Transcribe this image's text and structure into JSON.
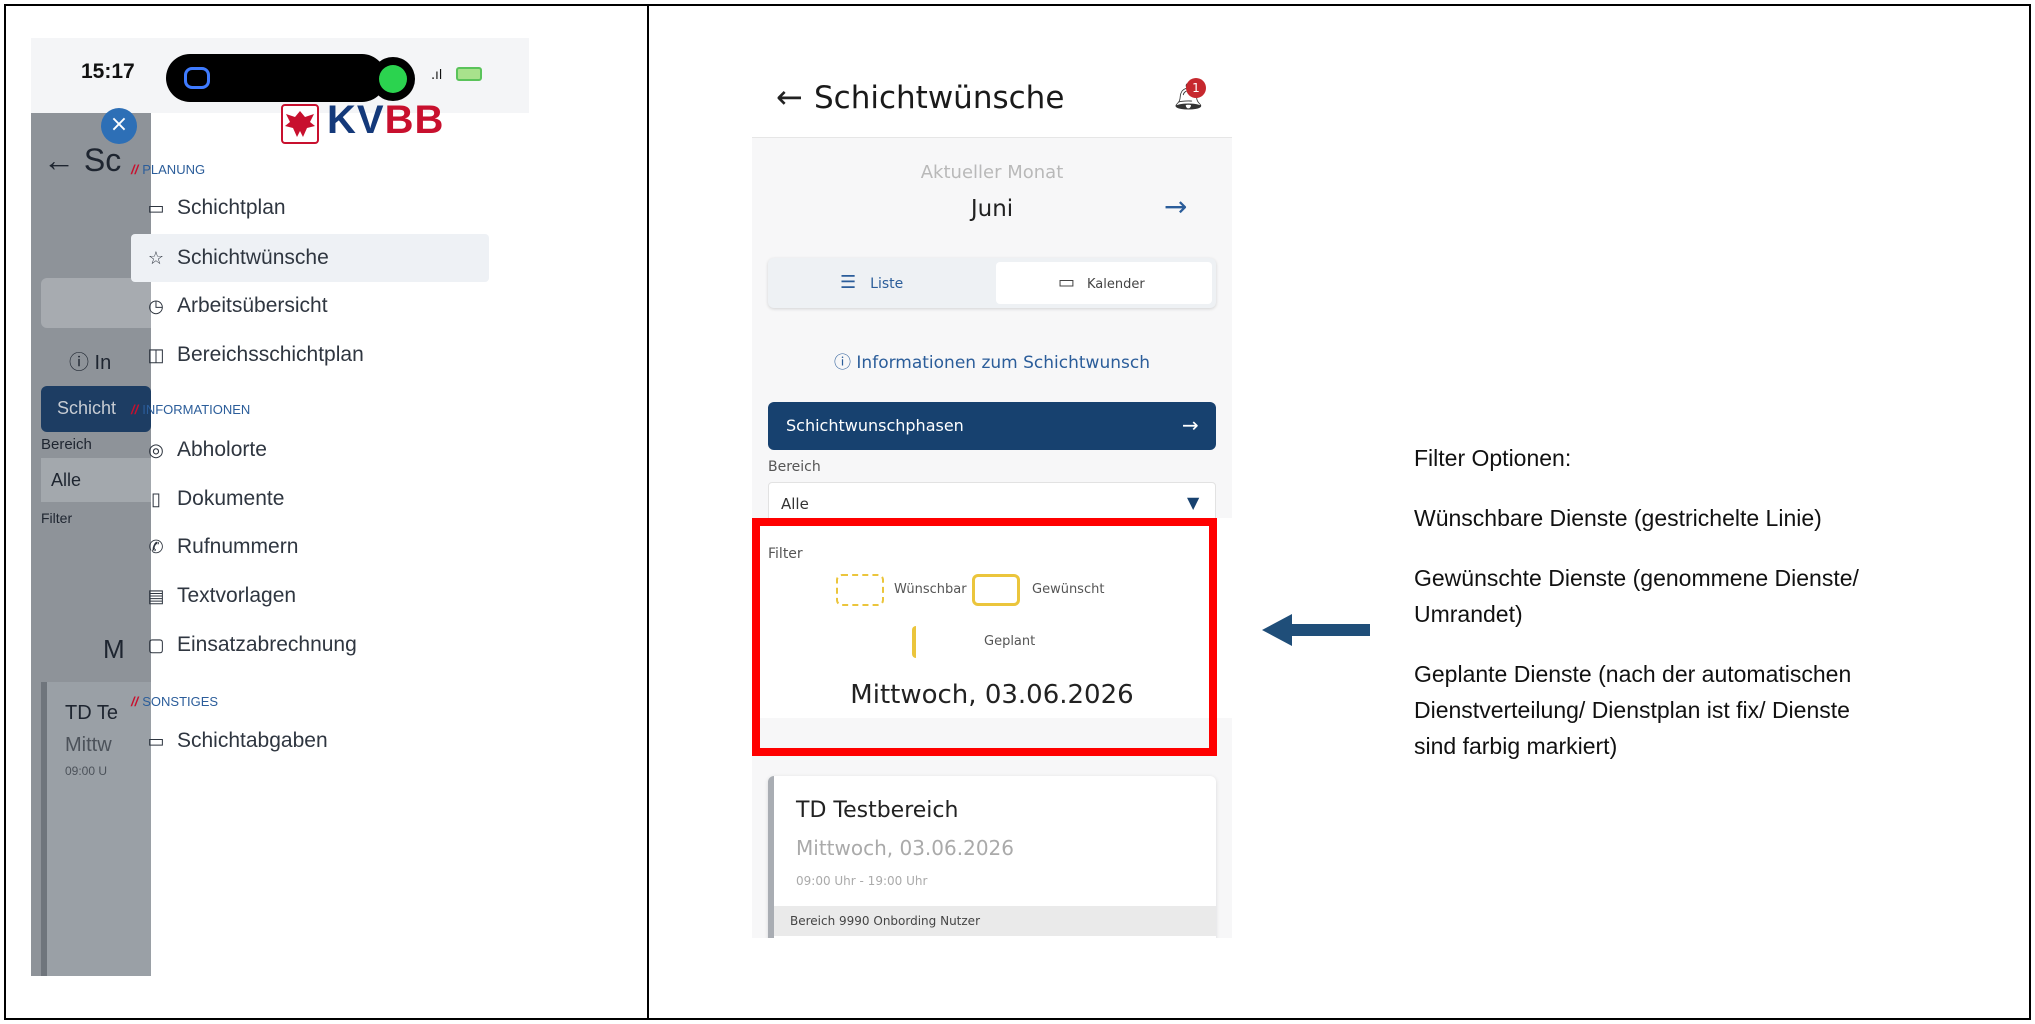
{
  "left_phone": {
    "status_time": "15:17",
    "brand": {
      "kv": "KV",
      "bb": "BB"
    },
    "sections": [
      {
        "label": "PLANUNG"
      },
      {
        "label": "INFORMATIONEN"
      },
      {
        "label": "SONSTIGES"
      }
    ],
    "menu_items": [
      {
        "label": "Schichtplan",
        "icon": "calendar-icon"
      },
      {
        "label": "Schichtwünsche",
        "icon": "star-icon"
      },
      {
        "label": "Arbeitsübersicht",
        "icon": "clock-icon"
      },
      {
        "label": "Bereichsschichtplan",
        "icon": "columns-icon"
      },
      {
        "label": "Abholorte",
        "icon": "location-icon"
      },
      {
        "label": "Dokumente",
        "icon": "document-icon"
      },
      {
        "label": "Rufnummern",
        "icon": "phone-icon"
      },
      {
        "label": "Textvorlagen",
        "icon": "template-icon"
      },
      {
        "label": "Einsatzabrechnung",
        "icon": "clipboard-icon"
      },
      {
        "label": "Schichtabgaben",
        "icon": "calendar-icon"
      }
    ],
    "background_fragments": {
      "back_title": "← Sc",
      "info": "ⓘ In",
      "schicht": "Schicht",
      "bereich": "Bereich",
      "alle": "Alle",
      "filter": "Filter",
      "m": "M",
      "td": "TD Te",
      "mittw": "Mittw",
      "time": "09:00 U"
    }
  },
  "middle_phone": {
    "title": "Schichtwünsche",
    "notification_count": "1",
    "current_month_label": "Aktueller Monat",
    "current_month": "Juni",
    "view_tabs": {
      "list": "Liste",
      "calendar": "Kalender"
    },
    "info_link": "Informationen zum Schichtwunsch",
    "phases_button": "Schichtwunschphasen",
    "bereich_label": "Bereich",
    "bereich_value": "Alle",
    "filter_label": "Filter",
    "legend": {
      "wishable": "Wünschbar",
      "wished": "Gewünscht",
      "planned": "Geplant"
    },
    "date_heading": "Mittwoch, 03.06.2026",
    "card": {
      "title": "TD Testbereich",
      "date": "Mittwoch, 03.06.2026",
      "time": "09:00 Uhr - 19:00 Uhr",
      "area": "Bereich 9990 Onbording Nutzer"
    }
  },
  "annotation": {
    "heading": "Filter Optionen:",
    "line1": "Wünschbare Dienste (gestrichelte Linie)",
    "line2a": "Gewünschte Dienste (genommene Dienste/",
    "line2b": "Umrandet)",
    "line3a": "Geplante Dienste (nach der automatischen",
    "line3b": "Dienstverteilung/ Dienstplan ist fix/ Dienste",
    "line3c": "sind farbig markiert)"
  },
  "colors": {
    "highlight": "#ff0000",
    "arrow": "#1f4e79",
    "brand_blue": "#14397a",
    "brand_red": "#c8102e",
    "primary": "#17416f"
  }
}
